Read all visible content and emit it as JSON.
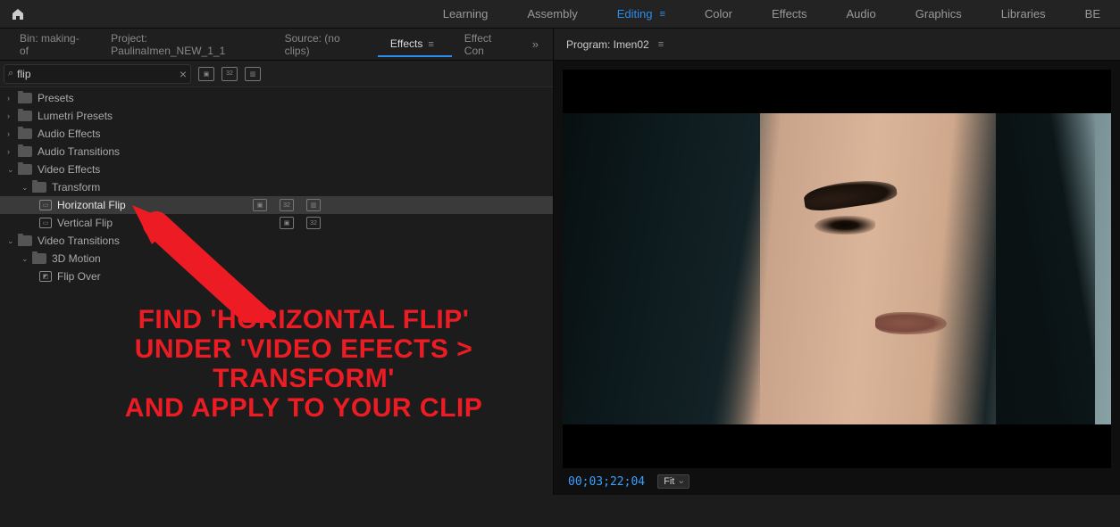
{
  "topbar": {
    "workspaces": {
      "learning": "Learning",
      "assembly": "Assembly",
      "editing": "Editing",
      "color": "Color",
      "effects": "Effects",
      "audio": "Audio",
      "graphics": "Graphics",
      "libraries": "Libraries",
      "more": "BE"
    }
  },
  "panel_tabs": {
    "bin": "Bin: making-of",
    "project": "Project: PaulinaImen_NEW_1_1",
    "source": "Source: (no clips)",
    "effects": "Effects",
    "effect_controls": "Effect Con"
  },
  "search": {
    "value": "flip"
  },
  "tree": {
    "presets": "Presets",
    "lumetri_presets": "Lumetri Presets",
    "audio_effects": "Audio Effects",
    "audio_transitions": "Audio Transitions",
    "video_effects": "Video Effects",
    "transform": "Transform",
    "horizontal_flip": "Horizontal Flip",
    "vertical_flip": "Vertical Flip",
    "video_transitions": "Video Transitions",
    "three_d_motion": "3D Motion",
    "flip_over": "Flip Over"
  },
  "program": {
    "title": "Program: Imen02",
    "timecode": "00;03;22;04",
    "fit_label": "Fit"
  },
  "annotation": {
    "line1": "Find 'Horizontal Flip'",
    "line2": "under 'Video Efects > Transform'",
    "line3": "and apply to your clip"
  }
}
